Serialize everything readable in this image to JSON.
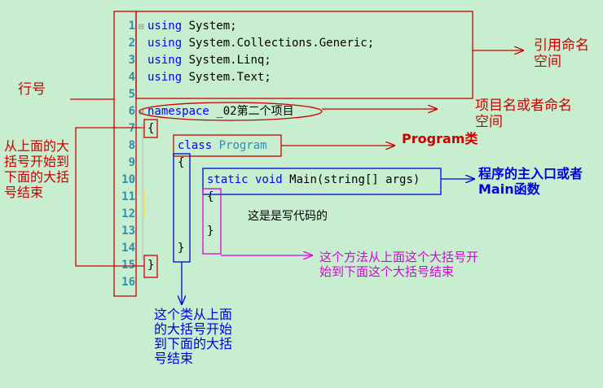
{
  "line_numbers": [
    "1",
    "2",
    "3",
    "4",
    "5",
    "6",
    "7",
    "8",
    "9",
    "10",
    "11",
    "12",
    "13",
    "14",
    "15",
    "16"
  ],
  "code": {
    "using1_kw": "using",
    "using1_ns": " System;",
    "using2_kw": "using",
    "using2_ns": " System.Collections.Generic;",
    "using3_kw": "using",
    "using3_ns": " System.Linq;",
    "using4_kw": "using",
    "using4_ns": " System.Text;",
    "ns_kw": "namespace",
    "ns_name": " _02第二个项目",
    "brace_open_ns": "{",
    "class_kw": "class",
    "class_name": " Program",
    "brace_open_class": "{",
    "method_static": "static",
    "method_void": " void",
    "method_sig": " Main(string[] args)",
    "brace_open_method": "{",
    "brace_close_method": "}",
    "brace_close_class": "}",
    "brace_close_ns": "}",
    "fold_minus": "⊟"
  },
  "annotations": {
    "using_ns": "引用命名空间",
    "line_number": "行号",
    "project_ns": "项目名或者命名空间",
    "program_class": "Program类",
    "main_entry": "程序的主入口或者Main函数",
    "ns_brace": "从上面的大括号开始到下面的大括号结束",
    "write_code": "这是是写代码的",
    "method_brace": "这个方法从上面这个大括号开始到下面这个大括号结束",
    "class_brace": "这个类从上面的大括号开始到下面的大括号结束"
  },
  "colors": {
    "background": "#c7efcf",
    "line_number": "#2b91af",
    "keyword": "#0000ff",
    "type": "#2b91af",
    "red_note": "#cc0000",
    "blue_note": "#0000dd",
    "magenta_note": "#dd00dd"
  }
}
